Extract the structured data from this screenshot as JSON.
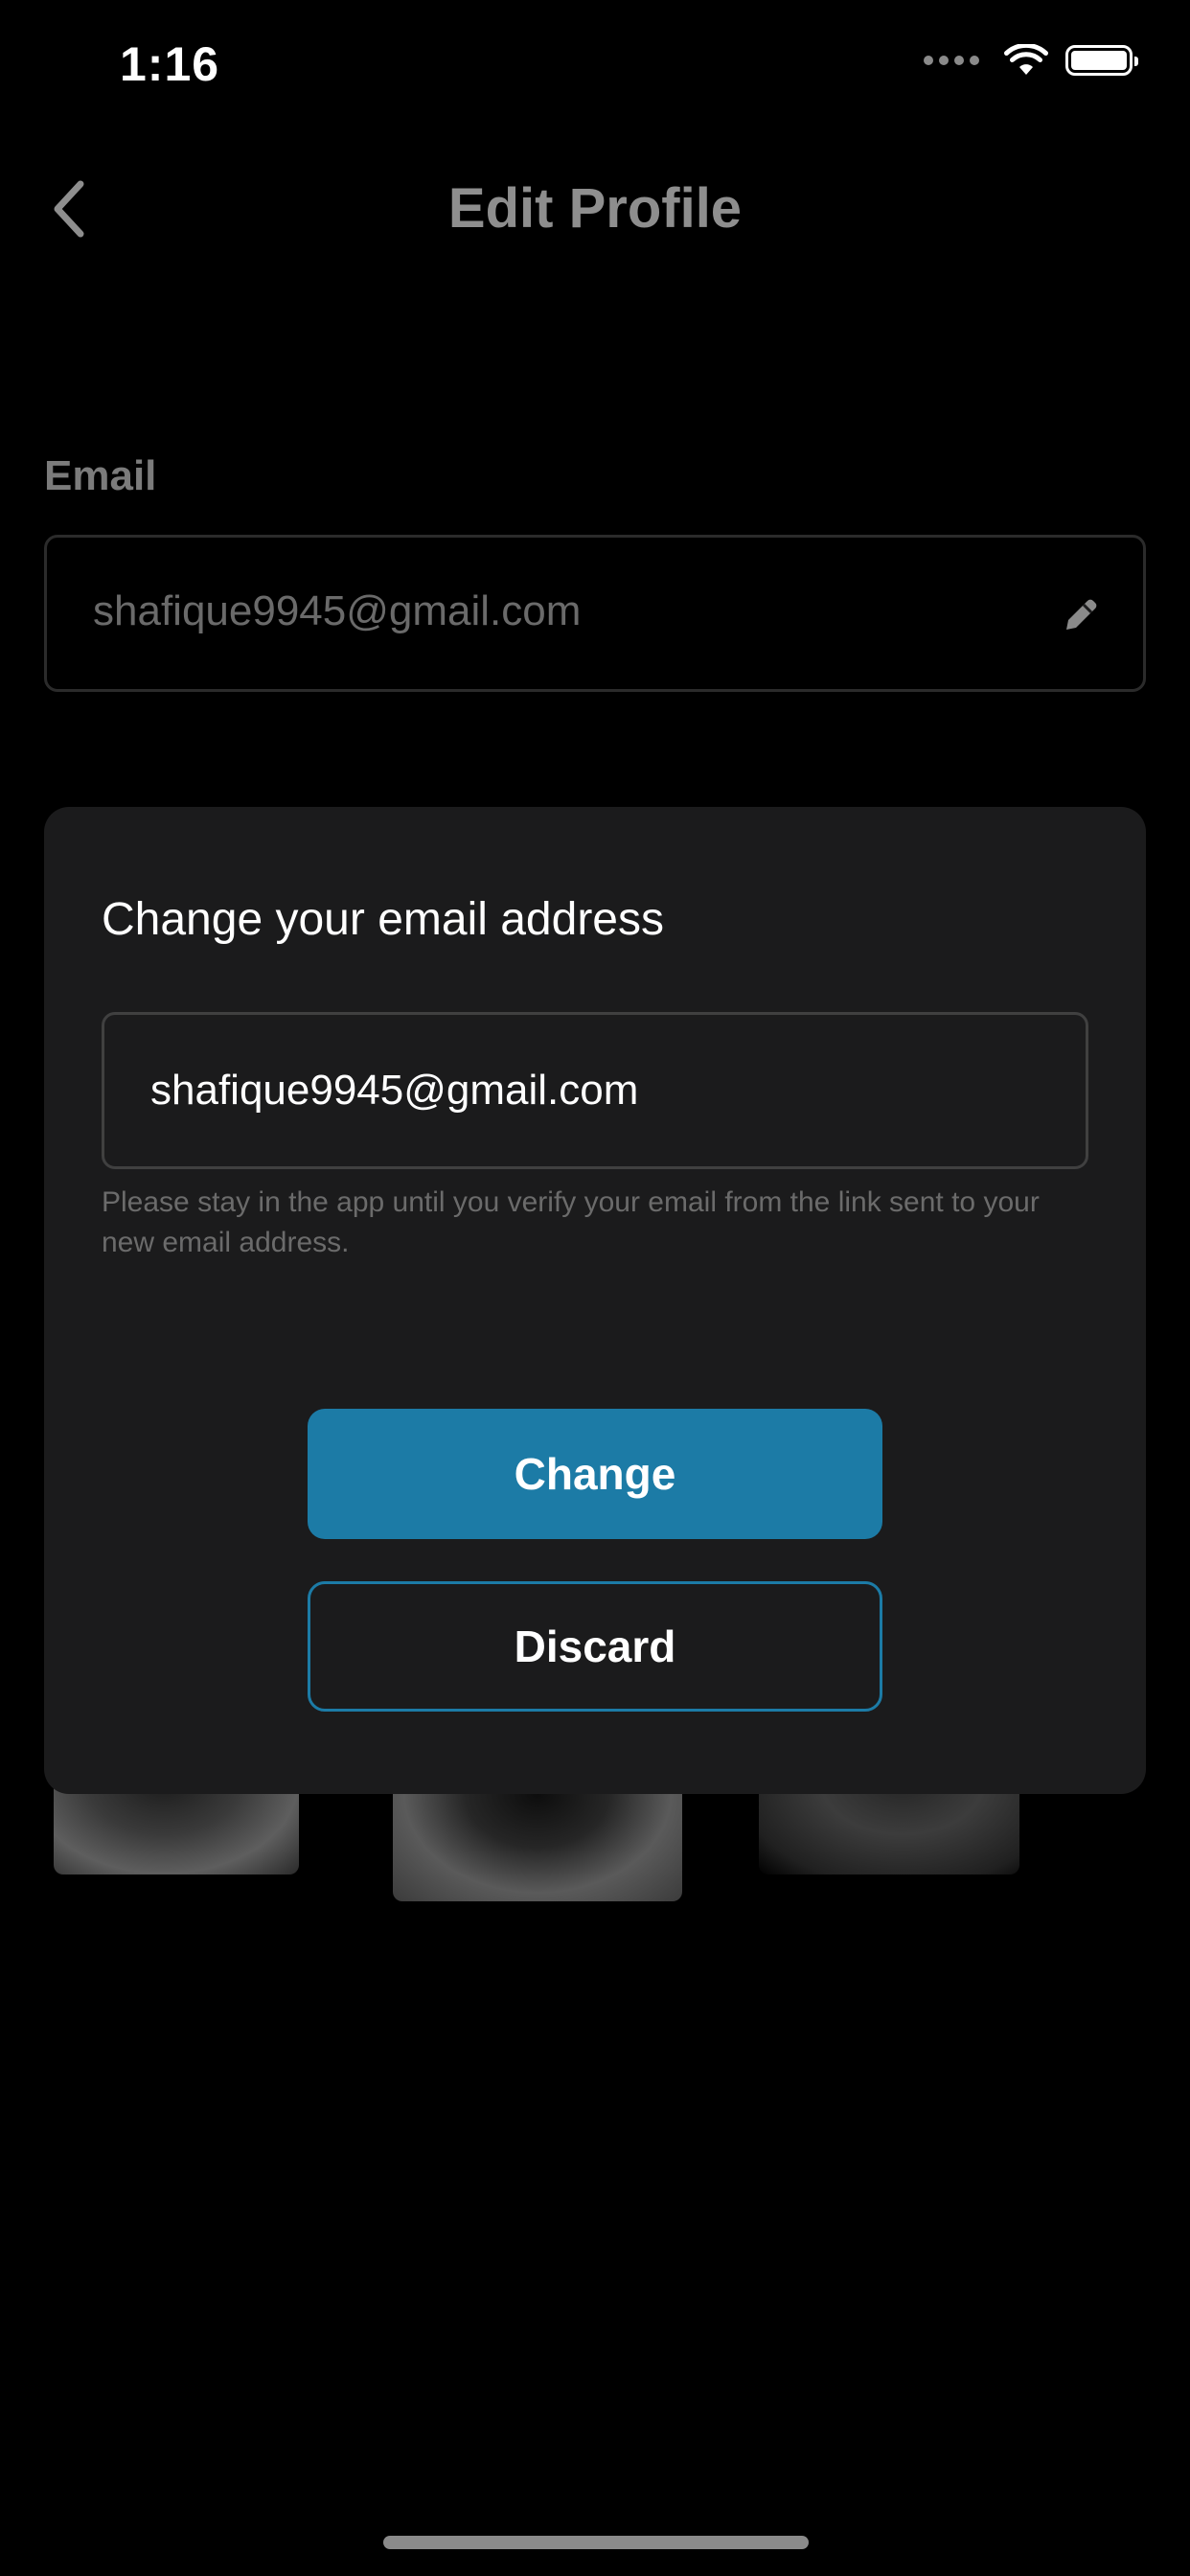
{
  "status_bar": {
    "time": "1:16",
    "icons": [
      "signal-dots-icon",
      "wifi-icon",
      "battery-icon"
    ]
  },
  "header": {
    "title": "Edit Profile",
    "back_icon": "chevron-left-icon"
  },
  "email_section": {
    "label": "Email",
    "value": "shafique9945@gmail.com",
    "edit_icon": "pencil-icon"
  },
  "modal": {
    "title": "Change your email address",
    "input_value": "shafique9945@gmail.com",
    "helper_text": "Please stay in the app until you verify your email from the link sent to your new email address.",
    "change_label": "Change",
    "discard_label": "Discard"
  },
  "colors": {
    "background": "#000000",
    "modal_background": "#1b1b1c",
    "accent": "#1c7ba6",
    "muted_text": "#8e8e8e"
  }
}
